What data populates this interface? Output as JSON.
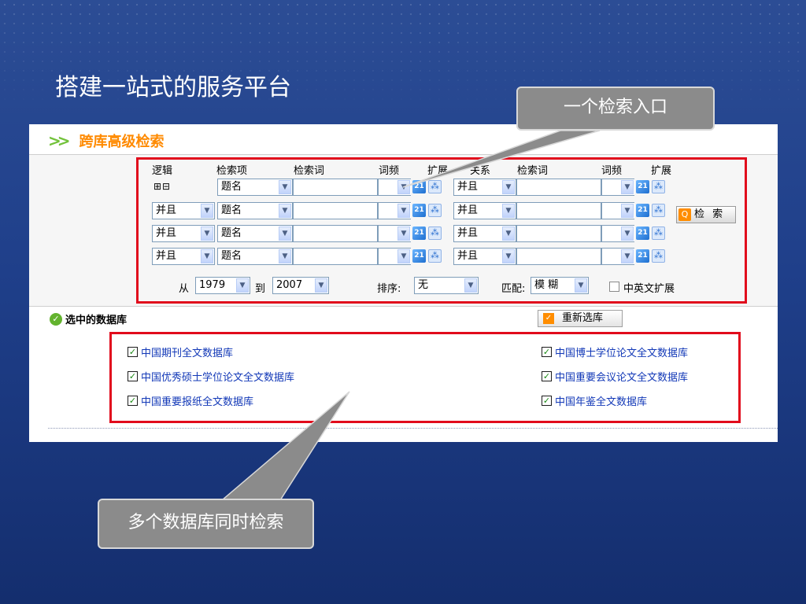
{
  "slide": {
    "title": "搭建一站式的服务平台"
  },
  "callouts": {
    "top": "一个检索入口",
    "bottom": "多个数据库同时检索"
  },
  "panel": {
    "title": "跨库高级检索"
  },
  "form": {
    "headers": [
      "逻辑",
      "检索项",
      "检索词",
      "词频",
      "扩展",
      "关系",
      "检索词",
      "词频",
      "扩展"
    ],
    "row1_logic_icons": "⊞⊟",
    "logic_value": "并且",
    "field_value": "题名",
    "relation_value": "并且",
    "search_button": "检 索",
    "range": {
      "from_label": "从",
      "from_year": "1979",
      "to_label": "到",
      "to_year": "2007"
    },
    "sort": {
      "label": "排序:",
      "value": "无"
    },
    "match": {
      "label": "匹配:",
      "value": "模 糊"
    },
    "cn_en_ext": "中英文扩展"
  },
  "databases": {
    "label": "选中的数据库",
    "reselect_button": "重新选库",
    "left": [
      "中国期刊全文数据库",
      "中国优秀硕士学位论文全文数据库",
      "中国重要报纸全文数据库"
    ],
    "right": [
      "中国博士学位论文全文数据库",
      "中国重要会议论文全文数据库",
      "中国年鉴全文数据库"
    ]
  },
  "icons": {
    "frequency": "frequency-icon",
    "expand": "expand-icon",
    "check": "checkmark-icon",
    "search": "magnifier-icon"
  },
  "colors": {
    "highlight_frame": "#e10b1c",
    "panel_title": "#ff8a00",
    "link": "#1238b7",
    "callout": "#8b8b8b",
    "background": "#1f3f8a"
  }
}
